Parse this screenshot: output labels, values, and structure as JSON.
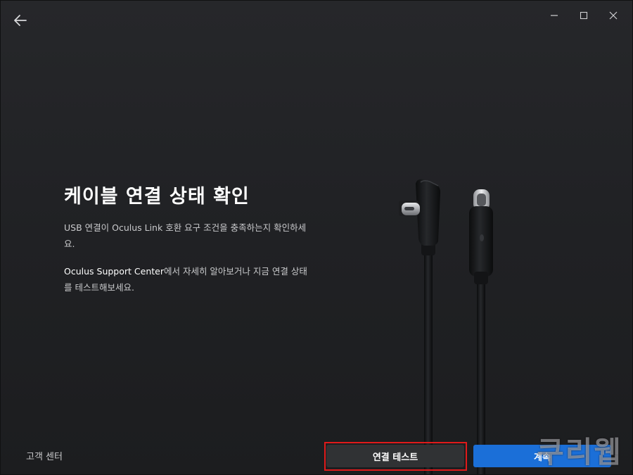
{
  "header": {
    "back_icon": "arrow-left-icon",
    "window_controls": [
      "minimize-icon",
      "maximize-icon",
      "close-icon"
    ]
  },
  "main": {
    "title": "케이블 연결 상태 확인",
    "description_1": "USB 연결이 Oculus Link 호환 요구 조건을 충족하는지 확인하세요.",
    "description_2_link": "Oculus Support Center",
    "description_2_text": "에서 자세히 알아보거나 지금 연결 상태를 테스트해보세요."
  },
  "illustration": {
    "icon": "usb-c-cable-icon",
    "cable_color": "#111214"
  },
  "footer": {
    "support_link": "고객 센터",
    "test_button": "연결 테스트",
    "continue_button": "계속"
  },
  "overlay": {
    "watermark": "쿠리웹",
    "highlight_color": "#e01a1a"
  },
  "colors": {
    "background": "#202124",
    "accent": "#1b6fd8"
  }
}
